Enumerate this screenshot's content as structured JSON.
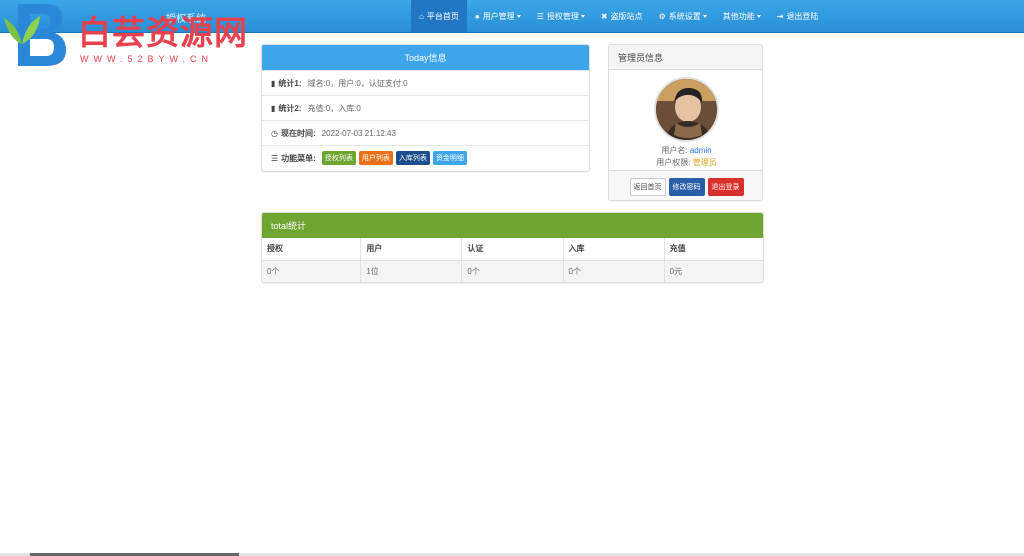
{
  "header": {
    "brand_title": "授权系统",
    "logo_text": "白芸资源网",
    "logo_sub": "WWW.52BYW.CN",
    "nav": [
      {
        "label": "平台首页",
        "icon": "home-icon",
        "glyph": "⌂",
        "active": true,
        "dropdown": false
      },
      {
        "label": "用户管理",
        "icon": "user-icon",
        "glyph": "●",
        "active": false,
        "dropdown": true
      },
      {
        "label": "授权管理",
        "icon": "list-icon",
        "glyph": "☰",
        "active": false,
        "dropdown": true
      },
      {
        "label": "盗版站点",
        "icon": "close-icon",
        "glyph": "✖",
        "active": false,
        "dropdown": false
      },
      {
        "label": "系统设置",
        "icon": "gear-icon",
        "glyph": "⚙",
        "active": false,
        "dropdown": true
      },
      {
        "label": "其他功能",
        "icon": "",
        "glyph": "",
        "active": false,
        "dropdown": true
      },
      {
        "label": "退出登陆",
        "icon": "logout-icon",
        "glyph": "⇥",
        "active": false,
        "dropdown": false
      }
    ]
  },
  "today": {
    "title": "Today信息",
    "stat1_label": "统计1:",
    "stat1_value": "域名:0，用户:0，认证支付:0",
    "stat2_label": "统计2:",
    "stat2_value": "充值:0，入库:0",
    "time_label": "现在时间:",
    "time_value": "2022-07-03 21:12:43",
    "menu_label": "功能菜单:",
    "menu_tags": [
      {
        "label": "授权列表",
        "color": "#6fa531"
      },
      {
        "label": "用户列表",
        "color": "#e8711a"
      },
      {
        "label": "入库列表",
        "color": "#1d4f8c"
      },
      {
        "label": "资金明细",
        "color": "#3da6ea"
      }
    ]
  },
  "admin": {
    "title": "管理员信息",
    "username_label": "用户名:",
    "username": "admin",
    "role_label": "用户权限:",
    "role": "管理员",
    "buttons": {
      "home": "返回首页",
      "change_password": "修改密码",
      "logout": "退出登录"
    }
  },
  "total": {
    "title": "total统计",
    "columns": [
      "授权",
      "用户",
      "认证",
      "入库",
      "充值"
    ],
    "values": [
      "0个",
      "1位",
      "0个",
      "0个",
      "0元"
    ]
  },
  "colors": {
    "nav_blue": "#2b8fd6",
    "panel_blue": "#3da6ea",
    "panel_green": "#6fa531",
    "danger": "#d9302c"
  }
}
